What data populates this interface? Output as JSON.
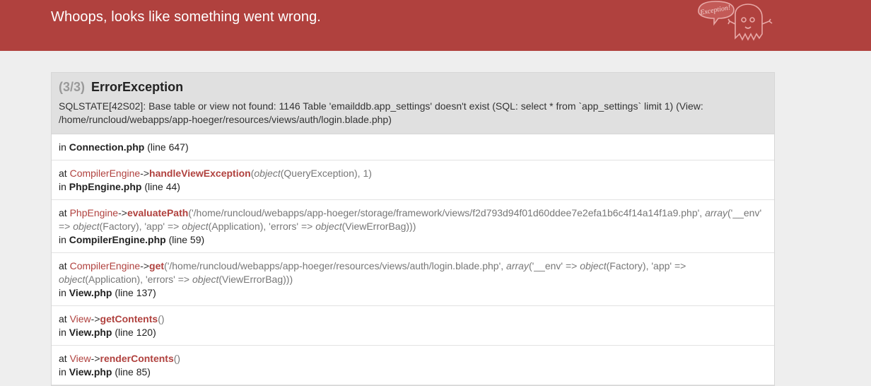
{
  "header": {
    "title": "Whoops, looks like something went wrong.",
    "ghost_badge": "Exception!",
    "background": "#b0413e"
  },
  "exception": {
    "count": "(3/3)",
    "name": "ErrorException",
    "message": "SQLSTATE[42S02]: Base table or view not found: 1146 Table 'emailddb.app_settings' doesn't exist (SQL: select * from `app_settings` limit 1) (View: /home/runcloud/webapps/app-hoeger/resources/views/auth/login.blade.php)"
  },
  "trace": [
    {
      "in_label": "in",
      "file": "Connection.php",
      "line": "(line 647)"
    },
    {
      "at_label": "at",
      "class": "CompilerEngine",
      "arrow": "->",
      "method": "handleViewException",
      "open": "(",
      "args_parts": [
        {
          "t": "kw",
          "v": "object"
        },
        {
          "t": "txt",
          "v": "(QueryException), 1"
        }
      ],
      "close": ")",
      "in_label": "in",
      "file": "PhpEngine.php",
      "line": "(line 44)"
    },
    {
      "at_label": "at",
      "class": "PhpEngine",
      "arrow": "->",
      "method": "evaluatePath",
      "open": "(",
      "args_parts": [
        {
          "t": "txt",
          "v": "'/home/runcloud/webapps/app-hoeger/storage/framework/views/f2d793d94f01d60ddee7e2efa1b6c4f14a14f1a9.php', "
        },
        {
          "t": "kw",
          "v": "array"
        },
        {
          "t": "txt",
          "v": "('__env' => "
        },
        {
          "t": "kw",
          "v": "object"
        },
        {
          "t": "txt",
          "v": "(Factory), 'app' => "
        },
        {
          "t": "kw",
          "v": "object"
        },
        {
          "t": "txt",
          "v": "(Application), 'errors' => "
        },
        {
          "t": "kw",
          "v": "object"
        },
        {
          "t": "txt",
          "v": "(ViewErrorBag))"
        }
      ],
      "close": ")",
      "in_label": "in",
      "file": "CompilerEngine.php",
      "line": "(line 59)"
    },
    {
      "at_label": "at",
      "class": "CompilerEngine",
      "arrow": "->",
      "method": "get",
      "open": "(",
      "args_parts": [
        {
          "t": "txt",
          "v": "'/home/runcloud/webapps/app-hoeger/resources/views/auth/login.blade.php', "
        },
        {
          "t": "kw",
          "v": "array"
        },
        {
          "t": "txt",
          "v": "('__env' => "
        },
        {
          "t": "kw",
          "v": "object"
        },
        {
          "t": "txt",
          "v": "(Factory), 'app' => "
        },
        {
          "t": "kw",
          "v": "object"
        },
        {
          "t": "txt",
          "v": "(Application), 'errors' => "
        },
        {
          "t": "kw",
          "v": "object"
        },
        {
          "t": "txt",
          "v": "(ViewErrorBag))"
        }
      ],
      "close": ")",
      "in_label": "in",
      "file": "View.php",
      "line": "(line 137)"
    },
    {
      "at_label": "at",
      "class": "View",
      "arrow": "->",
      "method": "getContents",
      "open": "(",
      "args_parts": [],
      "close": ")",
      "in_label": "in",
      "file": "View.php",
      "line": "(line 120)"
    },
    {
      "at_label": "at",
      "class": "View",
      "arrow": "->",
      "method": "renderContents",
      "open": "(",
      "args_parts": [],
      "close": ")",
      "in_label": "in",
      "file": "View.php",
      "line": "(line 85)"
    }
  ]
}
